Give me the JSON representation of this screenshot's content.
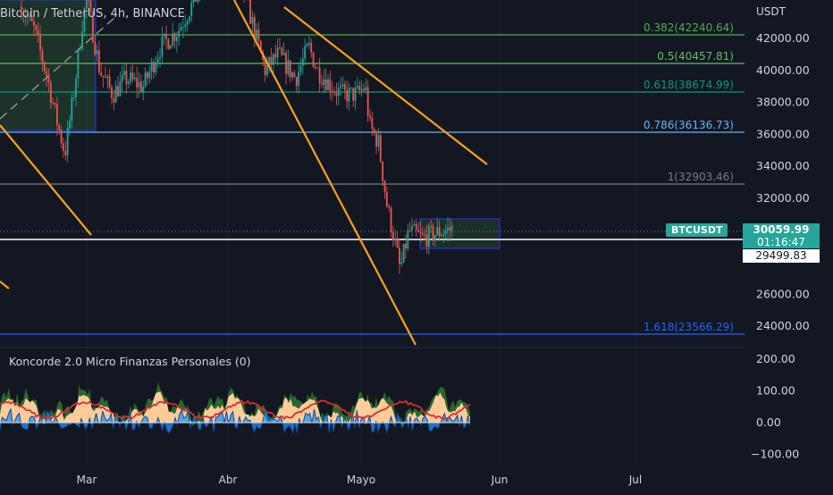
{
  "header": {
    "symbol_title": "Bitcoin / TetherUS, 4h, BINANCE"
  },
  "indicator": {
    "title": "Koncorde 2.0 Micro Finanzas Personales (0)"
  },
  "price_axis": {
    "unit": "USDT",
    "ticks": [
      "42000.00",
      "40000.00",
      "38000.00",
      "36000.00",
      "34000.00",
      "32000.00",
      "26000.00",
      "24000.00"
    ]
  },
  "indicator_axis": {
    "ticks": [
      "200.00",
      "100.00",
      "0.00",
      "−100.00"
    ]
  },
  "time_axis": {
    "labels": [
      "Mar",
      "Abr",
      "Mayo",
      "Jun",
      "Jul"
    ]
  },
  "fib_levels": [
    {
      "label": "0.382(42240.64)",
      "color": "#4caf50"
    },
    {
      "label": "0.5(40457.81)",
      "color": "#66bb6a"
    },
    {
      "label": "0.618(38674.99)",
      "color": "#089981"
    },
    {
      "label": "0.786(36136.73)",
      "color": "#64b5f6"
    },
    {
      "label": "1(32903.46)",
      "color": "#787b86"
    },
    {
      "label": "1.618(23566.29)",
      "color": "#2962ff"
    }
  ],
  "current_price": {
    "symbol": "BTCUSDT",
    "price": "30059.99",
    "countdown": "01:16:47",
    "crosshair_price": "29499.83"
  },
  "colors": {
    "background": "#131722",
    "bull": "#26a69a",
    "bear": "#ef5350",
    "trendline": "#f7a21b",
    "box_border": "#2a2ed9",
    "ind_fill": "#ffcc99",
    "ind_blue": "#2196f3",
    "ind_green": "#2e7d32",
    "ind_red": "#d32f2f"
  },
  "chart_data": {
    "type": "candlestick",
    "interval": "4h",
    "y_range": [
      22800,
      45500
    ],
    "indicator_range": [
      -120,
      200
    ],
    "close_path": [
      {
        "t": "Feb 14",
        "p": 44000
      },
      {
        "t": "Feb 17",
        "p": 42500
      },
      {
        "t": "Feb 20",
        "p": 39500
      },
      {
        "t": "Feb 22",
        "p": 37000
      },
      {
        "t": "Feb 24",
        "p": 34800
      },
      {
        "t": "Feb 26",
        "p": 38500
      },
      {
        "t": "Feb 28",
        "p": 43000
      },
      {
        "t": "Mar 1",
        "p": 44500
      },
      {
        "t": "Mar 4",
        "p": 40000
      },
      {
        "t": "Mar 7",
        "p": 38500
      },
      {
        "t": "Mar 10",
        "p": 39500
      },
      {
        "t": "Mar 14",
        "p": 39000
      },
      {
        "t": "Mar 18",
        "p": 41500
      },
      {
        "t": "Mar 22",
        "p": 42500
      },
      {
        "t": "Mar 26",
        "p": 44500
      },
      {
        "t": "Mar 29",
        "p": 47000
      },
      {
        "t": "Apr 2",
        "p": 46500
      },
      {
        "t": "Apr 5",
        "p": 46000
      },
      {
        "t": "Apr 8",
        "p": 43000
      },
      {
        "t": "Apr 11",
        "p": 40000
      },
      {
        "t": "Apr 14",
        "p": 41000
      },
      {
        "t": "Apr 18",
        "p": 39500
      },
      {
        "t": "Apr 21",
        "p": 41500
      },
      {
        "t": "Apr 23",
        "p": 40000
      },
      {
        "t": "Apr 27",
        "p": 38800
      },
      {
        "t": "Apr 29",
        "p": 38500
      },
      {
        "t": "May 2",
        "p": 38500
      },
      {
        "t": "May 4",
        "p": 39000
      },
      {
        "t": "May 5",
        "p": 36500
      },
      {
        "t": "May 7",
        "p": 35500
      },
      {
        "t": "May 9",
        "p": 31500
      },
      {
        "t": "May 11",
        "p": 29000
      },
      {
        "t": "May 12",
        "p": 27500
      },
      {
        "t": "May 14",
        "p": 30000
      },
      {
        "t": "May 17",
        "p": 29500
      },
      {
        "t": "May 20",
        "p": 29800
      },
      {
        "t": "May 24",
        "p": 30100
      }
    ]
  }
}
